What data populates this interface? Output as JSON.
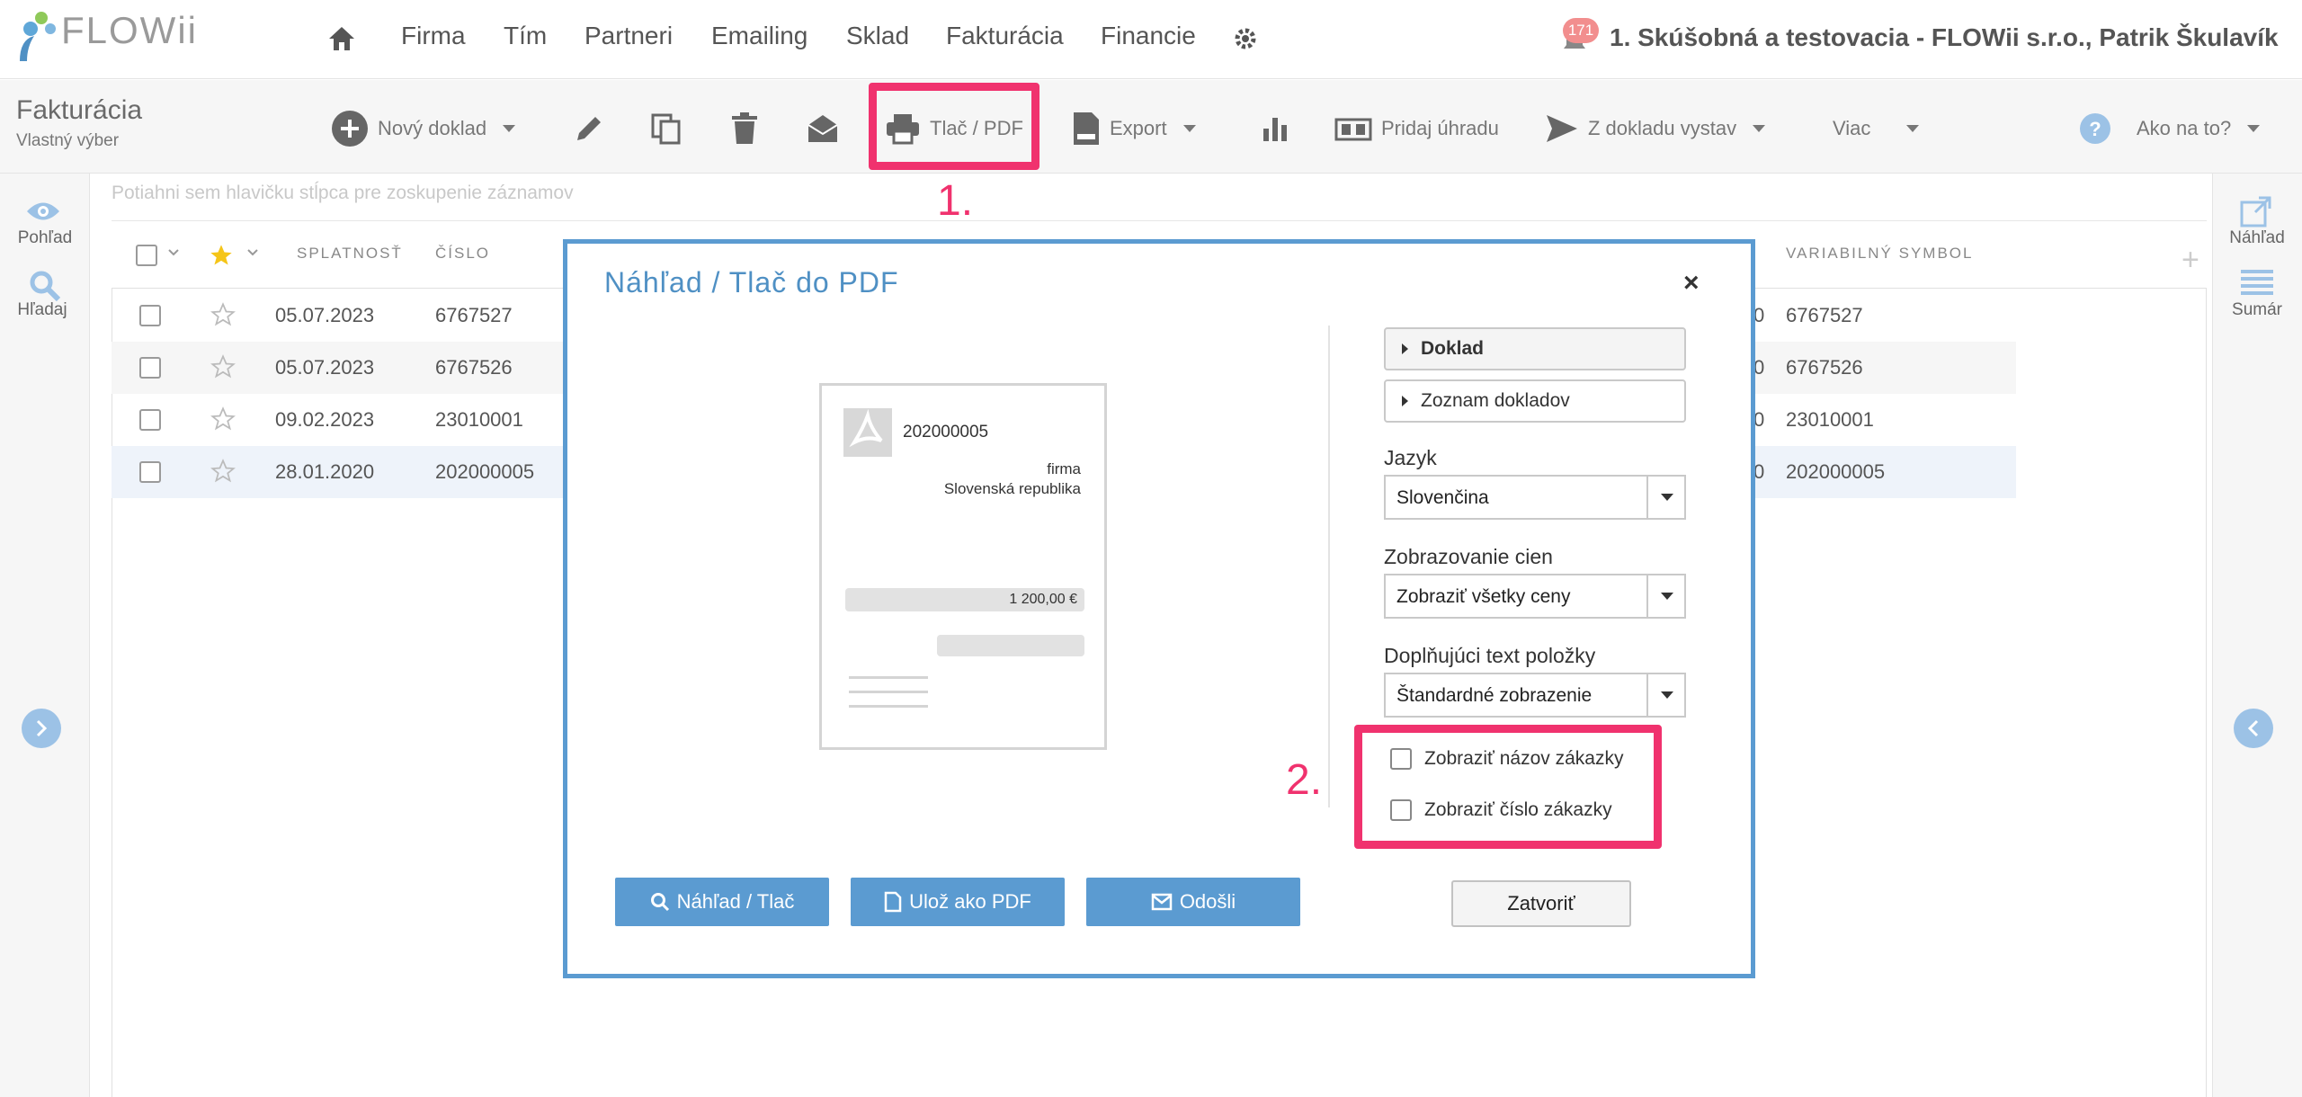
{
  "app": {
    "logo": "FLOWii",
    "company_user": "1. Skúšobná a testovacia - FLOWii s.r.o., Patrik Škulavík",
    "notification_count": "171"
  },
  "nav": {
    "items": [
      "Firma",
      "Tím",
      "Partneri",
      "Emailing",
      "Sklad",
      "Fakturácia",
      "Financie"
    ]
  },
  "toolbar": {
    "title": "Fakturácia",
    "subtitle": "Vlastný výber",
    "new_doc": "Nový doklad",
    "print_pdf": "Tlač / PDF",
    "export": "Export",
    "add_payment": "Pridaj úhradu",
    "from_doc": "Z dokladu vystav",
    "more": "Viac",
    "help": "Ako na to?"
  },
  "annotations": {
    "step1": "1.",
    "step2": "2."
  },
  "left_panel": {
    "view": "Pohľad",
    "search": "Hľadaj"
  },
  "right_panel": {
    "preview": "Náhľad",
    "summary": "Sumár"
  },
  "grid": {
    "group_hint": "Potiahni sem hlavičku stĺpca pre zoskupenie záznamov",
    "columns": {
      "due": "SPLATNOSŤ",
      "number": "ČÍSLO",
      "var_symbol": "VARIABILNÝ SYMBOL"
    },
    "rows": [
      {
        "due": "05.07.2023",
        "number": "6767527",
        "mid": "0",
        "vs": "6767527"
      },
      {
        "due": "05.07.2023",
        "number": "6767526",
        "mid": "0",
        "vs": "6767526"
      },
      {
        "due": "09.02.2023",
        "number": "23010001",
        "mid": "0",
        "vs": "23010001"
      },
      {
        "due": "28.01.2020",
        "number": "202000005",
        "mid": "0",
        "vs": "202000005"
      }
    ]
  },
  "modal": {
    "title": "Náhľad / Tlač do PDF",
    "close_x": "×",
    "preview": {
      "number": "202000005",
      "company": "firma",
      "country": "Slovenská republika",
      "amount": "1 200,00 €"
    },
    "accordion": {
      "doc": "Doklad",
      "doc_list": "Zoznam dokladov"
    },
    "language": {
      "label": "Jazyk",
      "value": "Slovenčina"
    },
    "prices": {
      "label": "Zobrazovanie cien",
      "value": "Zobraziť všetky ceny"
    },
    "item_text": {
      "label": "Doplňujúci text položky",
      "value": "Štandardné zobrazenie"
    },
    "checkboxes": {
      "order_name": "Zobraziť názov zákazky",
      "order_number": "Zobraziť číslo zákazky"
    },
    "buttons": {
      "preview_print": "Náhľad / Tlač",
      "save_pdf": "Ulož ako PDF",
      "send": "Odošli",
      "close": "Zatvoriť"
    }
  },
  "colors": {
    "accent": "#5b9bd1",
    "highlight": "#f0326e"
  }
}
